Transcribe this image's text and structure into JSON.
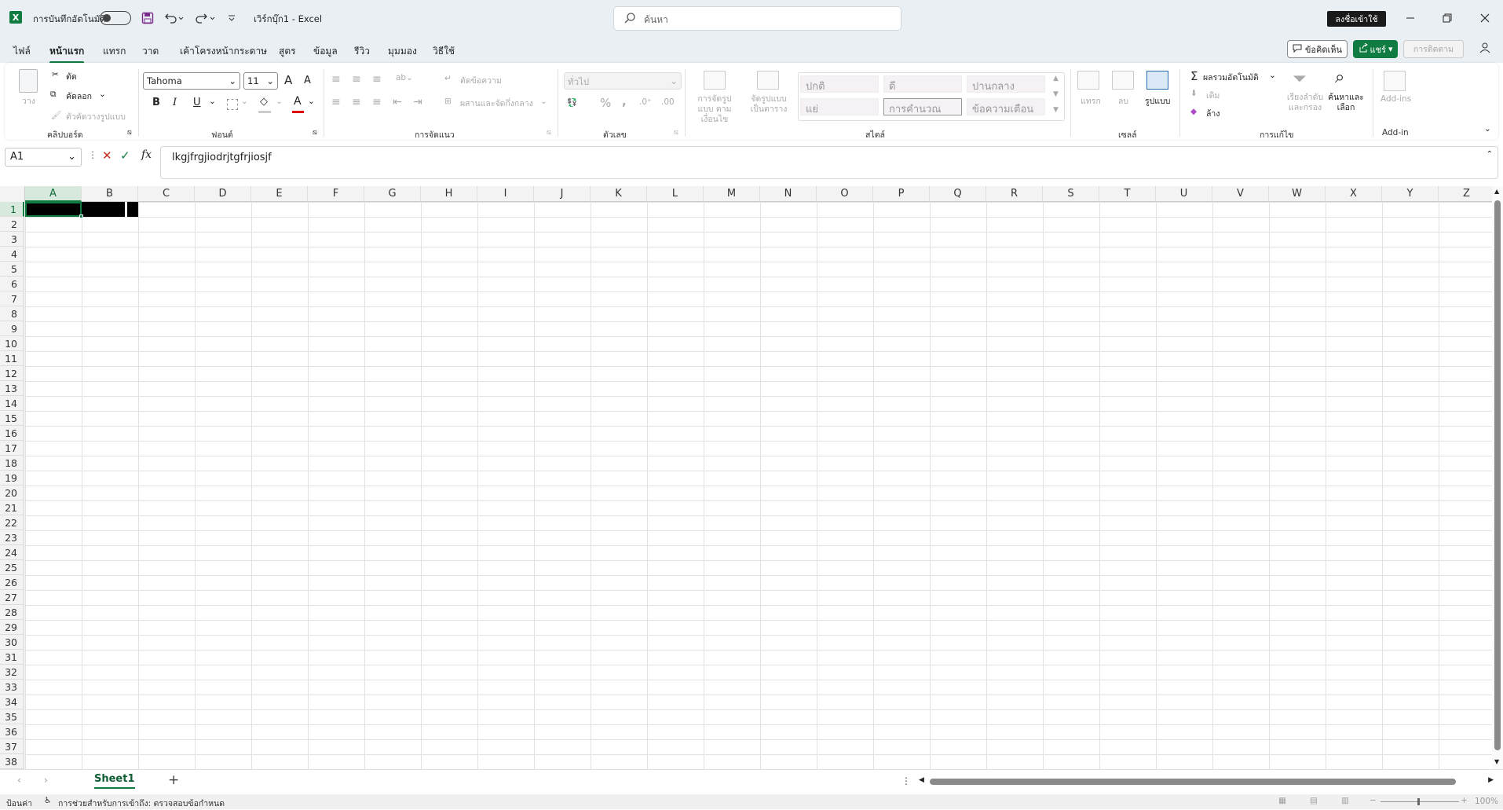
{
  "titlebar": {
    "app_icon_letter": "X",
    "autosave_label": "การบันทึกอัตโนมัติ",
    "document_title": "เวิร์กบุ๊ก1 - Excel",
    "search_placeholder": "ค้นหา",
    "signin_label": "ลงชื่อเข้าใช้"
  },
  "menu": {
    "tabs": [
      "ไฟล์",
      "หน้าแรก",
      "แทรก",
      "วาด",
      "เค้าโครงหน้ากระดาษ",
      "สูตร",
      "ข้อมูล",
      "รีวิว",
      "มุมมอง",
      "วิธีใช้"
    ],
    "active_tab": "หน้าแรก",
    "comments_label": "ข้อคิดเห็น",
    "share_label": "แชร์",
    "catchup_label": "การติดตาม"
  },
  "ribbon": {
    "clipboard": {
      "paste": "วาง",
      "cut": "ตัด",
      "copy": "คัดลอก",
      "format_painter": "ตัวคัดวางรูปแบบ",
      "group": "คลิปบอร์ด"
    },
    "font": {
      "name": "Tahoma",
      "size": "11",
      "group": "ฟอนต์",
      "bold": "B",
      "italic": "I",
      "underline": "U",
      "color_letter": "A",
      "grow": "A",
      "shrink": "A"
    },
    "alignment": {
      "wrap": "ตัดข้อความ",
      "merge": "ผสานและจัดกึ่งกลาง",
      "group": "การจัดแนว"
    },
    "number": {
      "format": "ทั่วไป",
      "percent": "%",
      "comma": ",",
      "group": "ตัวเลข"
    },
    "styles": {
      "conditional": "การจัดรูปแบบ ตามเงื่อนไข",
      "table": "จัดรูปแบบ เป็นตาราง",
      "cells": [
        "ปกติ",
        "ดี",
        "ปานกลาง",
        "แย่",
        "การคำนวณ",
        "ข้อความเตือน"
      ],
      "group": "สไตล์"
    },
    "cells_group": {
      "insert": "แทรก",
      "delete": "ลบ",
      "format": "รูปแบบ",
      "group": "เซลล์"
    },
    "editing": {
      "autosum": "ผลรวมอัตโนมัติ",
      "fill": "เติม",
      "clear": "ล้าง",
      "sort": "เรียงลำดับ และกรอง",
      "find": "ค้นหาและ เลือก",
      "group": "การแก้ไข"
    },
    "addins": {
      "label": "Add-ins",
      "group": "Add-in"
    }
  },
  "formula": {
    "namebox": "A1",
    "fx_label": "fx",
    "content": "lkgjfrgjiodrjtgfrjiosjf"
  },
  "grid": {
    "columns": [
      "A",
      "B",
      "C",
      "D",
      "E",
      "F",
      "G",
      "H",
      "I",
      "J",
      "K",
      "L",
      "M",
      "N",
      "O",
      "P",
      "Q",
      "R",
      "S",
      "T",
      "U",
      "V",
      "W",
      "X",
      "Y",
      "Z"
    ],
    "rows": [
      "1",
      "2",
      "3",
      "4",
      "5",
      "6",
      "7",
      "8",
      "9",
      "10",
      "11",
      "12",
      "13",
      "14",
      "15",
      "16",
      "17",
      "18",
      "19",
      "20",
      "21",
      "22",
      "23",
      "24",
      "25",
      "26",
      "27",
      "28",
      "29",
      "30",
      "31",
      "32",
      "33",
      "34",
      "35",
      "36",
      "37",
      "38"
    ]
  },
  "sheets": {
    "tabs": [
      "Sheet1"
    ],
    "add_label": "+"
  },
  "status": {
    "mode": "ป้อนค่า",
    "accessibility": "การช่วยสำหรับการเข้าถึง: ตรวจสอบข้อกำหนด",
    "zoom": "100%"
  }
}
